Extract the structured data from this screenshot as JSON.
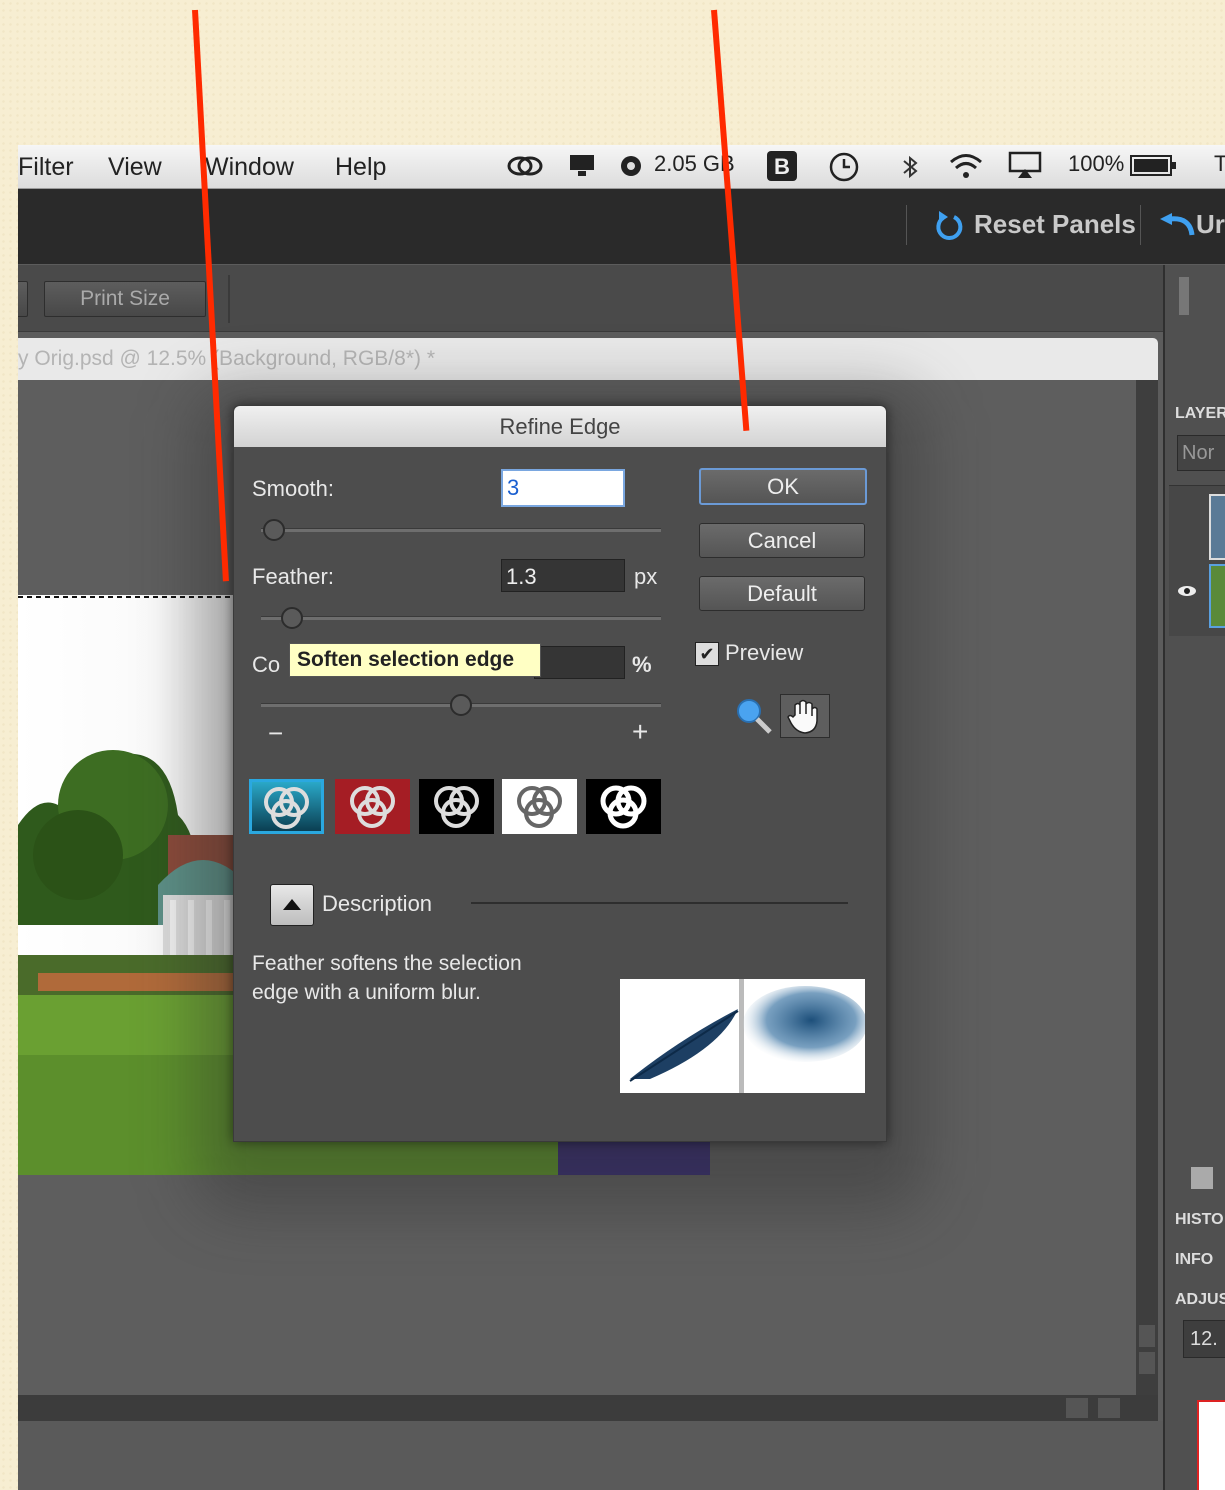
{
  "menubar": {
    "items": [
      "Filter",
      "View",
      "Window",
      "Help"
    ],
    "memory": "2.05 GB",
    "battery": "100%"
  },
  "topbar": {
    "reset_panels": "Reset Panels",
    "undo_partial": "Ur"
  },
  "options_bar": {
    "print_size": "Print Size"
  },
  "document_tab": {
    "title": "y Orig.psd @ 12.5% (Background, RGB/8*) *"
  },
  "right_panel": {
    "layers": "LAYER",
    "blend_mode": "Nor",
    "history": "HISTO",
    "info": "INFO",
    "adjustments": "ADJUS",
    "zoom_field": "12."
  },
  "refine_edge": {
    "title": "Refine Edge",
    "smooth_label": "Smooth:",
    "smooth_value": "3",
    "feather_label": "Feather:",
    "feather_value": "1.3",
    "feather_unit": "px",
    "contrast_label_partial": "Co",
    "contrast_unit": "%",
    "minus": "−",
    "plus": "+",
    "tooltip": "Soften selection edge",
    "ok": "OK",
    "cancel": "Cancel",
    "default": "Default",
    "preview_label": "Preview",
    "preview_checked": true,
    "description_header": "Description",
    "description_text_line1": "Feather softens the selection",
    "description_text_line2": "edge with a uniform blur.",
    "smooth_slider_level": 0.0,
    "feather_slider_level": 0.07,
    "contrast_slider_level": 0.5
  },
  "colors": {
    "annotation_line": "#ff2a00",
    "background_paper": "#f7eed2"
  }
}
